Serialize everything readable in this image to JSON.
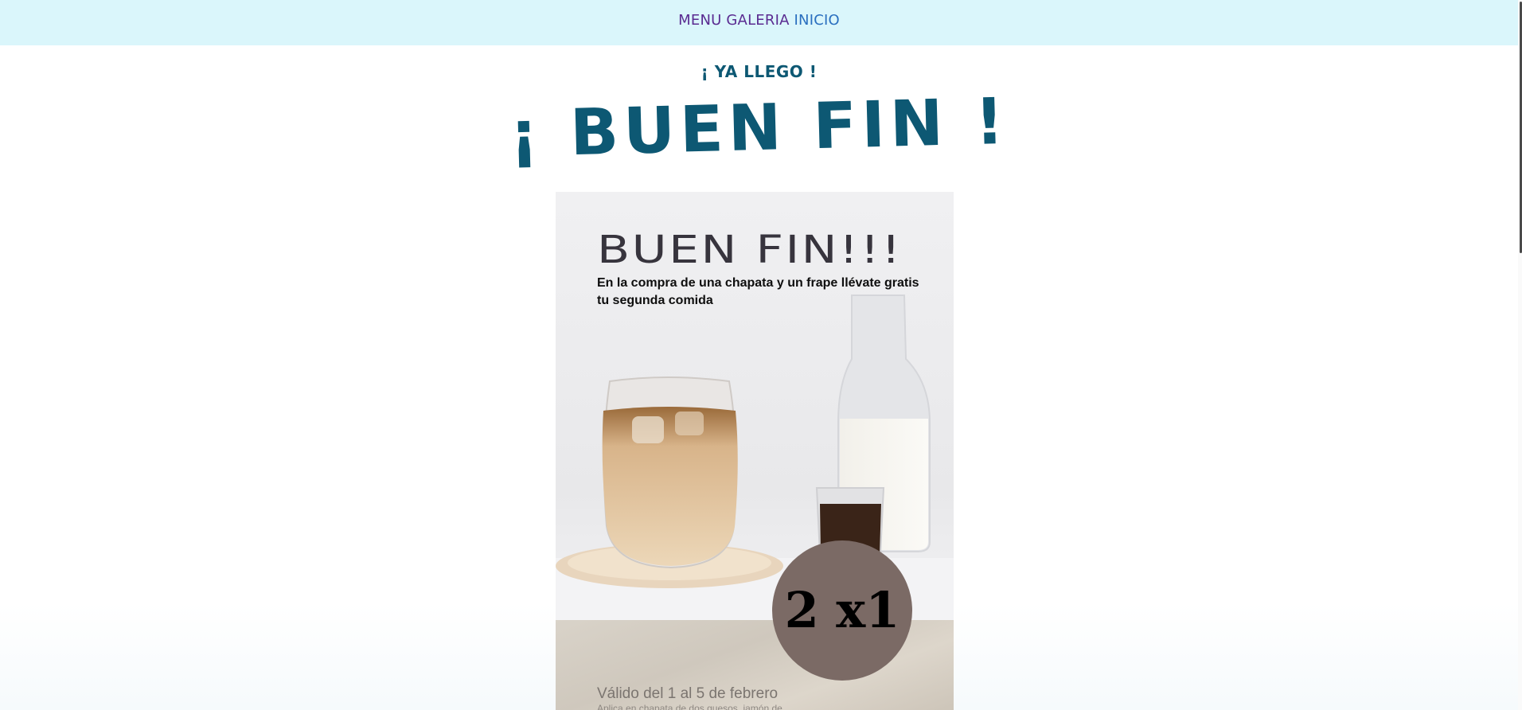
{
  "nav": {
    "links": [
      "MENU",
      "GALERIA",
      "INICIO"
    ]
  },
  "hero": {
    "kicker": "¡ YA LLEGO !",
    "headline": "¡ BUEN FIN !"
  },
  "poster": {
    "title": "BUEN FIN!!!",
    "body": "En la compra de una chapata y un frape llévate gratis tu segunda comida",
    "badge": "2 x1",
    "valid": "Válido del 1 al 5 de febrero",
    "applies": "Aplica en chapata de dos quesos, jamón de"
  },
  "colors": {
    "nav_bg": "#daf6fb",
    "headline": "#0d5873",
    "badge": "#7b6a65"
  }
}
